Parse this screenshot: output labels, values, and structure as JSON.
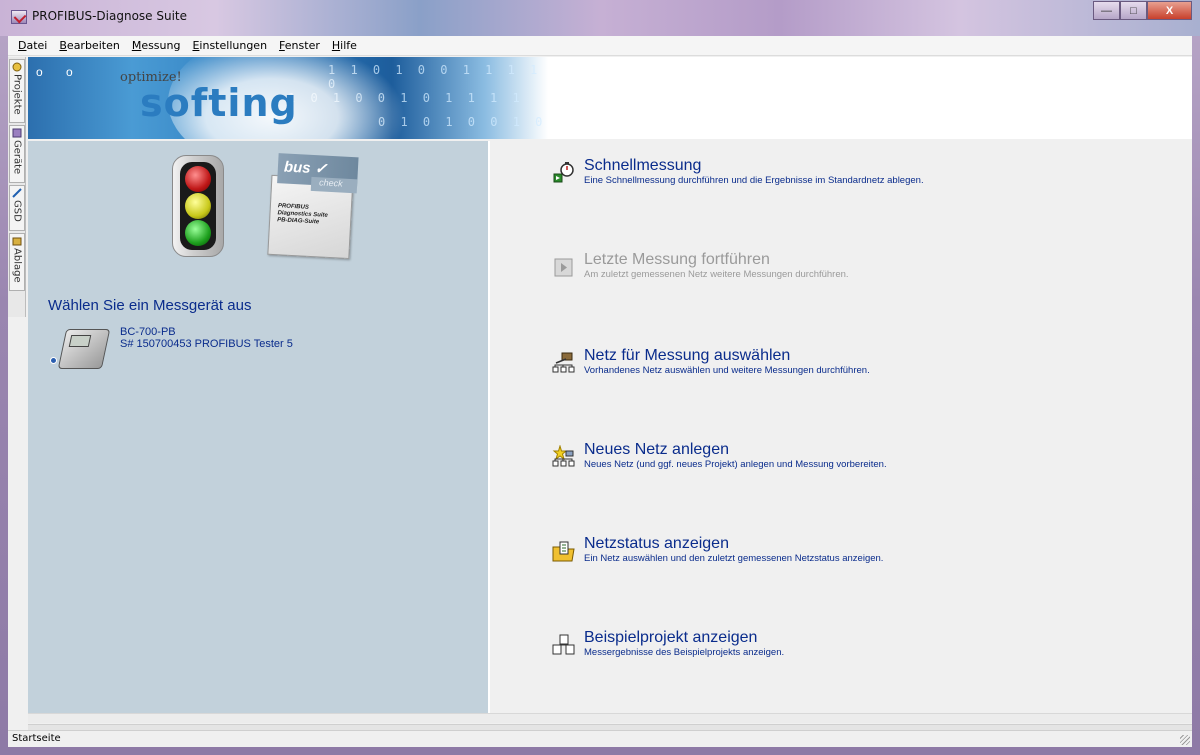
{
  "window": {
    "title": "PROFIBUS-Diagnose Suite",
    "buttons": {
      "minimize": "—",
      "maximize": "□",
      "close": "X"
    }
  },
  "menubar": {
    "items": [
      {
        "label": "Datei",
        "accel": "D",
        "rest": "atei"
      },
      {
        "label": "Bearbeiten",
        "accel": "B",
        "rest": "earbeiten"
      },
      {
        "label": "Messung",
        "accel": "M",
        "rest": "essung"
      },
      {
        "label": "Einstellungen",
        "accel": "E",
        "rest": "instellungen"
      },
      {
        "label": "Fenster",
        "accel": "F",
        "rest": "enster"
      },
      {
        "label": "Hilfe",
        "accel": "H",
        "rest": "ilfe"
      }
    ]
  },
  "sidetabs": [
    "Projekte",
    "Geräte",
    "GSD",
    "Ablage"
  ],
  "banner": {
    "tagline": "optimize!",
    "brand": "softing",
    "bits_row1": "1 1 0 1 0 0 1 1 1 1 0",
    "bits_row2": "1 0 1   0 0 1 0 1   1 1 1",
    "bits_row3": "0 1   0 1 0 0 1 0",
    "dots": "o o"
  },
  "left": {
    "product_badge": "bus",
    "product_badge2": "check",
    "product_lines": [
      "PROFIBUS",
      "Diagnostics Suite",
      "PB-DIAG-Suite"
    ],
    "choose_label": "Wählen Sie ein Messgerät aus",
    "device": {
      "name": "BC-700-PB",
      "serial": "S# 150700453  PROFIBUS Tester 5"
    }
  },
  "actions": [
    {
      "label": "Schnellmessung",
      "desc": "Eine Schnellmessung durchführen und die Ergebnisse im Standardnetz ablegen.",
      "icon": "stopwatch-network-icon",
      "enabled": true
    },
    {
      "label": "Letzte Messung fortführen",
      "desc": "Am zuletzt gemessenen Netz weitere Messungen durchführen.",
      "icon": "play-icon",
      "enabled": false
    },
    {
      "label": "Netz für Messung auswählen",
      "desc": "Vorhandenes Netz auswählen und weitere Messungen durchführen.",
      "icon": "network-select-icon",
      "enabled": true
    },
    {
      "label": "Neues Netz anlegen",
      "desc": "Neues Netz (und ggf. neues Projekt) anlegen und Messung vorbereiten.",
      "icon": "new-network-icon",
      "enabled": true
    },
    {
      "label": "Netzstatus anzeigen",
      "desc": "Ein Netz auswählen und den zuletzt gemessenen Netzstatus anzeigen.",
      "icon": "folder-status-icon",
      "enabled": true
    },
    {
      "label": "Beispielprojekt anzeigen",
      "desc": "Messergebnisse des Beispielprojekts anzeigen.",
      "icon": "sample-project-icon",
      "enabled": true
    }
  ],
  "statusbar": {
    "text": "Startseite"
  },
  "colors": {
    "link_blue": "#0a2c8c",
    "disabled_gray": "#9a9a9a",
    "left_panel_bg": "#c2d1db"
  }
}
